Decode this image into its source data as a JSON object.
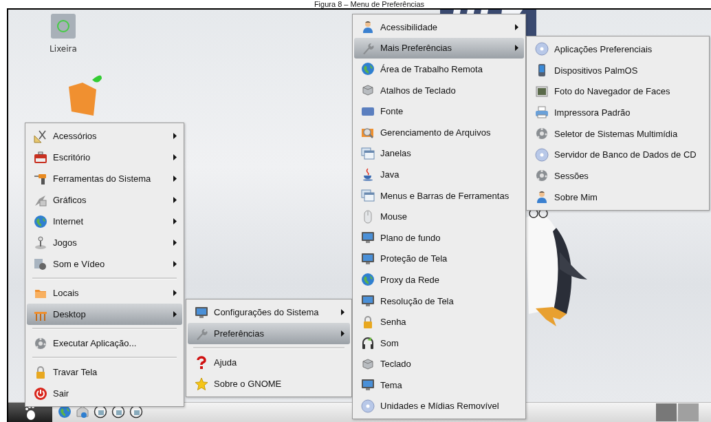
{
  "caption": "Figura 8 – Menu de Preferências",
  "desktop_icons": [
    {
      "label": "Lixeira"
    }
  ],
  "menus": [
    {
      "items": [
        {
          "kind": "item",
          "label": "Acessórios",
          "submenu": true,
          "selected": false
        },
        {
          "kind": "item",
          "label": "Escritório",
          "submenu": true,
          "selected": false
        },
        {
          "kind": "item",
          "label": "Ferramentas do Sistema",
          "submenu": true,
          "selected": false
        },
        {
          "kind": "item",
          "label": "Gráficos",
          "submenu": true,
          "selected": false
        },
        {
          "kind": "item",
          "label": "Internet",
          "submenu": true,
          "selected": false
        },
        {
          "kind": "item",
          "label": "Jogos",
          "submenu": true,
          "selected": false
        },
        {
          "kind": "item",
          "label": "Som e Vídeo",
          "submenu": true,
          "selected": false
        },
        {
          "kind": "separator"
        },
        {
          "kind": "item",
          "label": "Locais",
          "submenu": true,
          "selected": false
        },
        {
          "kind": "item",
          "label": "Desktop",
          "submenu": true,
          "selected": true
        },
        {
          "kind": "separator"
        },
        {
          "kind": "item",
          "label": "Executar Aplicação...",
          "submenu": false,
          "selected": false
        },
        {
          "kind": "separator"
        },
        {
          "kind": "item",
          "label": "Travar Tela",
          "submenu": false,
          "selected": false
        },
        {
          "kind": "item",
          "label": "Sair",
          "submenu": false,
          "selected": false
        }
      ]
    },
    {
      "items": [
        {
          "kind": "item",
          "label": "Configurações do Sistema",
          "submenu": true,
          "selected": false
        },
        {
          "kind": "item",
          "label": "Preferências",
          "submenu": true,
          "selected": true
        },
        {
          "kind": "separator"
        },
        {
          "kind": "item",
          "label": "Ajuda",
          "submenu": false,
          "selected": false
        },
        {
          "kind": "item",
          "label": "Sobre o GNOME",
          "submenu": false,
          "selected": false
        }
      ]
    },
    {
      "items": [
        {
          "kind": "item",
          "label": "Acessibilidade",
          "submenu": true,
          "selected": false
        },
        {
          "kind": "item",
          "label": "Mais Preferências",
          "submenu": true,
          "selected": true
        },
        {
          "kind": "item",
          "label": "Área de Trabalho Remota",
          "submenu": false,
          "selected": false
        },
        {
          "kind": "item",
          "label": "Atalhos de Teclado",
          "submenu": false,
          "selected": false
        },
        {
          "kind": "item",
          "label": "Fonte",
          "submenu": false,
          "selected": false
        },
        {
          "kind": "item",
          "label": "Gerenciamento de Arquivos",
          "submenu": false,
          "selected": false
        },
        {
          "kind": "item",
          "label": "Janelas",
          "submenu": false,
          "selected": false
        },
        {
          "kind": "item",
          "label": "Java",
          "submenu": false,
          "selected": false
        },
        {
          "kind": "item",
          "label": "Menus e Barras de Ferramentas",
          "submenu": false,
          "selected": false
        },
        {
          "kind": "item",
          "label": "Mouse",
          "submenu": false,
          "selected": false
        },
        {
          "kind": "item",
          "label": "Plano de fundo",
          "submenu": false,
          "selected": false
        },
        {
          "kind": "item",
          "label": "Proteção de Tela",
          "submenu": false,
          "selected": false
        },
        {
          "kind": "item",
          "label": "Proxy da Rede",
          "submenu": false,
          "selected": false
        },
        {
          "kind": "item",
          "label": "Resolução de Tela",
          "submenu": false,
          "selected": false
        },
        {
          "kind": "item",
          "label": "Senha",
          "submenu": false,
          "selected": false
        },
        {
          "kind": "item",
          "label": "Som",
          "submenu": false,
          "selected": false
        },
        {
          "kind": "item",
          "label": "Teclado",
          "submenu": false,
          "selected": false
        },
        {
          "kind": "item",
          "label": "Tema",
          "submenu": false,
          "selected": false
        },
        {
          "kind": "item",
          "label": "Unidades e Mídias Removível",
          "submenu": false,
          "selected": false
        }
      ]
    },
    {
      "items": [
        {
          "kind": "item",
          "label": "Aplicações Preferenciais",
          "submenu": false,
          "selected": false
        },
        {
          "kind": "item",
          "label": "Dispositivos PalmOS",
          "submenu": false,
          "selected": false
        },
        {
          "kind": "item",
          "label": "Foto do Navegador de Faces",
          "submenu": false,
          "selected": false
        },
        {
          "kind": "item",
          "label": "Impressora Padrão",
          "submenu": false,
          "selected": false
        },
        {
          "kind": "item",
          "label": "Seletor de Sistemas Multimídia",
          "submenu": false,
          "selected": false
        },
        {
          "kind": "item",
          "label": "Servidor de Banco de Dados de CD",
          "submenu": false,
          "selected": false
        },
        {
          "kind": "item",
          "label": "Sessões",
          "submenu": false,
          "selected": false
        },
        {
          "kind": "item",
          "label": "Sobre Mim",
          "submenu": false,
          "selected": false
        }
      ]
    }
  ]
}
